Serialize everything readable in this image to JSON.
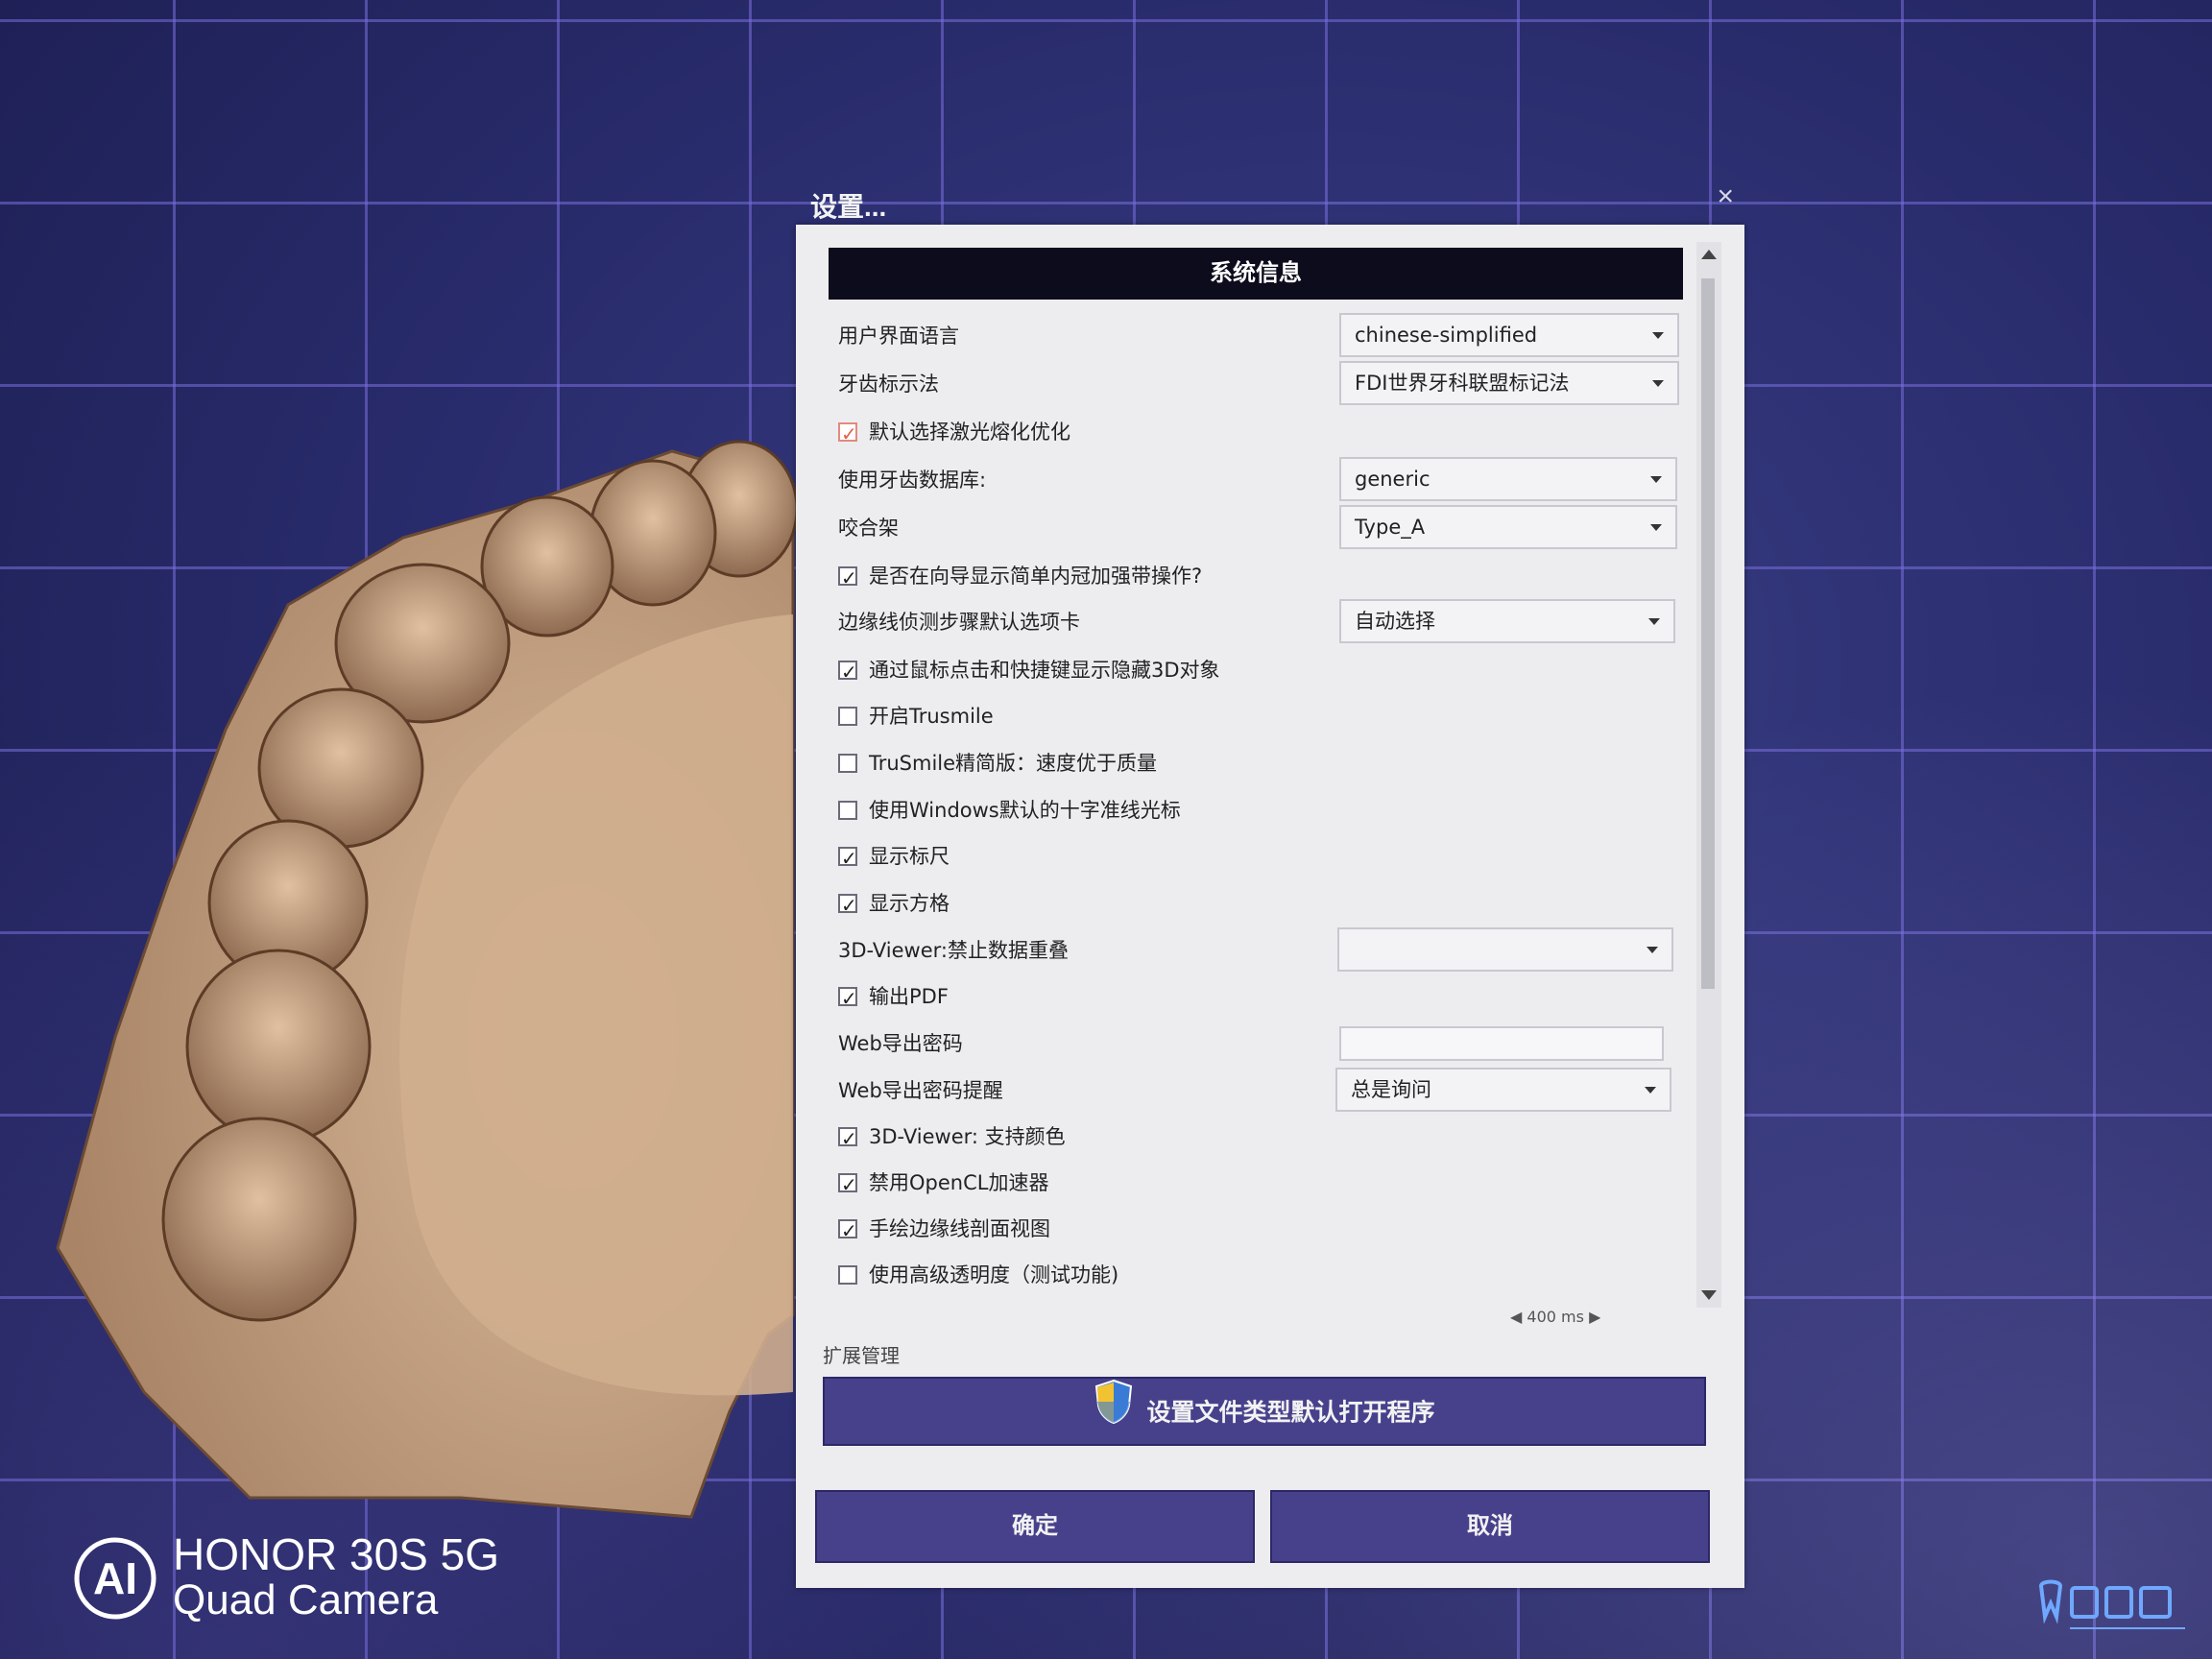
{
  "dialog": {
    "title": "设置...",
    "close_glyph": "×",
    "section_header": "系统信息",
    "rows": [
      {
        "kind": "select",
        "label": "用户界面语言",
        "value": "chinese-simplified"
      },
      {
        "kind": "select",
        "label": "牙齿标示法",
        "value": "FDI世界牙科联盟标记法"
      },
      {
        "kind": "checkbox",
        "label": "默认选择激光熔化优化",
        "checked": true
      },
      {
        "kind": "select",
        "label": "使用牙齿数据库:",
        "value": "generic"
      },
      {
        "kind": "select",
        "label": "咬合架",
        "value": "Type_A"
      },
      {
        "kind": "checkbox",
        "label": "是否在向导显示简单内冠加强带操作?",
        "checked": true
      },
      {
        "kind": "select",
        "label": "边缘线侦测步骤默认选项卡",
        "value": "自动选择"
      },
      {
        "kind": "checkbox",
        "label": "通过鼠标点击和快捷键显示隐藏3D对象",
        "checked": true
      },
      {
        "kind": "checkbox",
        "label": "开启Trusmile",
        "checked": false
      },
      {
        "kind": "checkbox",
        "label": "TruSmile精简版：速度优于质量",
        "checked": false
      },
      {
        "kind": "checkbox",
        "label": "使用Windows默认的十字准线光标",
        "checked": false
      },
      {
        "kind": "checkbox",
        "label": "显示标尺",
        "checked": true
      },
      {
        "kind": "checkbox",
        "label": "显示方格",
        "checked": true
      },
      {
        "kind": "select",
        "label": "3D-Viewer:禁止数据重叠",
        "value": ""
      },
      {
        "kind": "checkbox",
        "label": "输出PDF",
        "checked": true
      },
      {
        "kind": "text",
        "label": "Web导出密码",
        "value": ""
      },
      {
        "kind": "select",
        "label": "Web导出密码提醒",
        "value": "总是询问"
      },
      {
        "kind": "checkbox",
        "label": "3D-Viewer: 支持颜色",
        "checked": true
      },
      {
        "kind": "checkbox",
        "label": "禁用OpenCL加速器",
        "checked": true
      },
      {
        "kind": "checkbox",
        "label": "手绘边缘线剖面视图",
        "checked": true
      },
      {
        "kind": "checkbox",
        "label": "使用高级透明度（测试功能)",
        "checked": false
      }
    ],
    "stepper_value": "400",
    "stepper_unit": "ms",
    "extension_label": "扩展管理",
    "extension_button": "设置文件类型默认打开程序",
    "ok_button": "确定",
    "cancel_button": "取消"
  },
  "watermark": {
    "logo": "AI",
    "brand": "HONOR 30S 5G",
    "camera": "Quad Camera"
  },
  "colors": {
    "background": "#2a2d6e",
    "grid": "#786edc",
    "button": "#47418c",
    "header": "#0c0c1c",
    "panel": "#ededf0"
  }
}
